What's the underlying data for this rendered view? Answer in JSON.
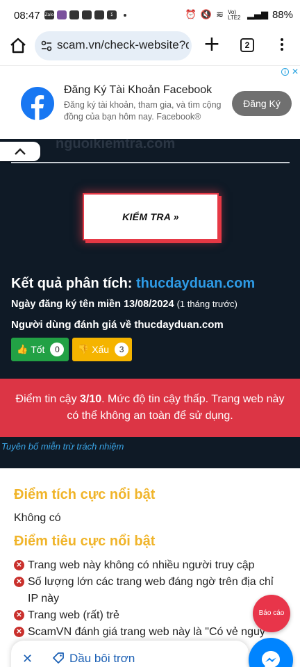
{
  "status_bar": {
    "time": "08:47",
    "network": "Vo) LTE2",
    "battery": "88%"
  },
  "browser": {
    "url": "scam.vn/check-website?d",
    "tab_count": "2"
  },
  "ad": {
    "title": "Đăng Ký Tài Khoản Facebook",
    "description": "Đăng ký tài khoản, tham gia, và tìm cộng đồng của bạn hôm nay. Facebook®",
    "cta": "Đăng Ký"
  },
  "checker": {
    "ghost_text": "nguoikiemtra.com",
    "check_button": "KIỂM TRA »",
    "result_label": "Kết quả phân tích:",
    "result_domain": "thucdayduan.com",
    "registration_label": "Ngày đăng ký tên miền 13/08/2024",
    "registration_relative": "(1 tháng trước)",
    "rating_label": "Người dùng đánh giá về thucdayduan.com",
    "good_label": "Tốt",
    "good_count": "0",
    "bad_label": "Xấu",
    "bad_count": "3",
    "alert_prefix": "Điểm tin cậy ",
    "alert_score": "3/10",
    "alert_suffix": ". Mức độ tin cậy thấp. Trang web này có thể không an toàn để sử dụng.",
    "disclaimer": "Tuyên bố miễn trừ trách nhiệm"
  },
  "highlights": {
    "positive_heading": "Điểm tích cực nổi bật",
    "positive_none": "Không có",
    "negative_heading": "Điểm tiêu cực nổi bật",
    "negatives": [
      "Trang web này không có nhiều người truy cập",
      "Số lượng lớn các trang web đáng ngờ trên địa chỉ IP này",
      "Trang web (rất) trẻ",
      "ScamVN đánh giá trang web này là \"Có vẻ nguy"
    ]
  },
  "report_button": "Báo cáo",
  "bottom_bar": {
    "text": "Dầu bôi trơn"
  },
  "colors": {
    "accent_blue": "#2e9be6",
    "alert_red": "#dc3545",
    "good_green": "#22a145",
    "bad_yellow": "#f5b400",
    "heading_gold": "#f0b429",
    "dark_bg": "#0f1a26"
  }
}
